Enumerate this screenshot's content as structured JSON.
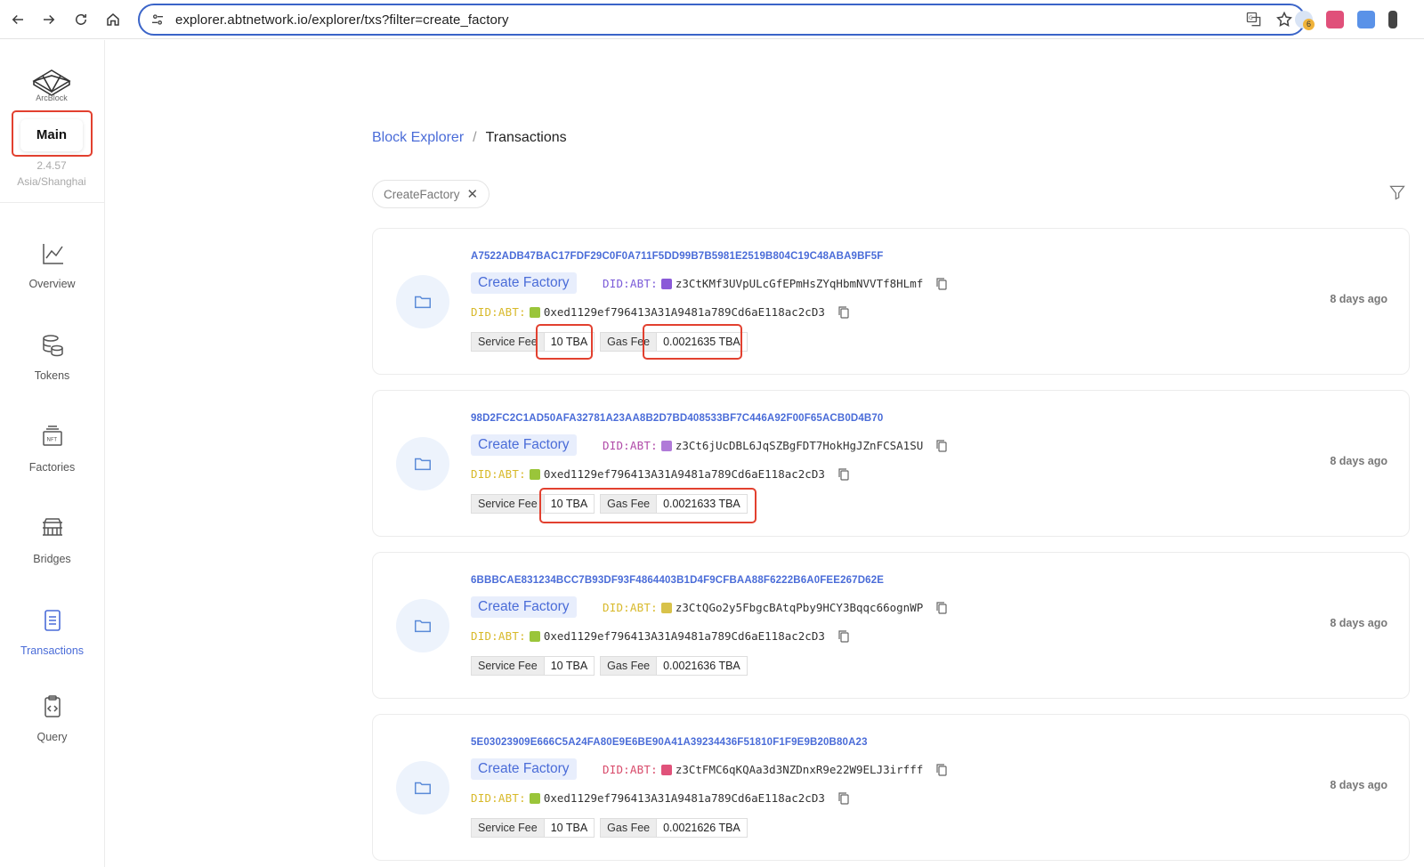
{
  "browser": {
    "url": "explorer.abtnetwork.io/explorer/txs?filter=create_factory",
    "ext_badge": "6"
  },
  "sidebar": {
    "brand": "ArcBlock",
    "network_label": "Main",
    "version": "2.4.57",
    "timezone": "Asia/Shanghai",
    "items": [
      {
        "label": "Overview",
        "icon": "chart-line-icon"
      },
      {
        "label": "Tokens",
        "icon": "coins-icon"
      },
      {
        "label": "Factories",
        "icon": "nft-icon"
      },
      {
        "label": "Bridges",
        "icon": "bridge-icon"
      },
      {
        "label": "Transactions",
        "icon": "document-icon",
        "active": true
      },
      {
        "label": "Query",
        "icon": "query-clipboard-icon"
      }
    ]
  },
  "breadcrumb": {
    "root": "Block Explorer",
    "separator": "/",
    "current": "Transactions"
  },
  "filter": {
    "chip_label": "CreateFactory",
    "chip_close": "✕"
  },
  "transactions": [
    {
      "hash": "A7522ADB47BAC17FDF29C0F0A711F5DD99B7B5981E2519B804C19C48ABA9BF5F",
      "type": "Create Factory",
      "did_prefix": "DID:ABT:",
      "factory_did": "z3CtKMf3UVpULcGfEPmHsZYqHbmNVVTf8HLmf",
      "factory_color": "#8a5ad8",
      "sender_did": "0xed1129ef796413A31A9481a789Cd6aE118ac2cD3",
      "sender_color": "#9ac53a",
      "service_fee_label": "Service Fee",
      "service_fee": "10 TBA",
      "gas_fee_label": "Gas Fee",
      "gas_fee": "0.0021635 TBA",
      "time": "8 days ago"
    },
    {
      "hash": "98D2FC2C1AD50AFA32781A23AA8B2D7BD408533BF7C446A92F00F65ACB0D4B70",
      "type": "Create Factory",
      "did_prefix": "DID:ABT:",
      "factory_did": "z3Ct6jUcDBL6JqSZBgFDT7HokHgJZnFCSA1SU",
      "factory_color": "#b07ad8",
      "sender_did": "0xed1129ef796413A31A9481a789Cd6aE118ac2cD3",
      "sender_color": "#9ac53a",
      "service_fee_label": "Service Fee",
      "service_fee": "10 TBA",
      "gas_fee_label": "Gas Fee",
      "gas_fee": "0.0021633 TBA",
      "time": "8 days ago"
    },
    {
      "hash": "6BBBCAE831234BCC7B93DF93F4864403B1D4F9CFBAA88F6222B6A0FEE267D62E",
      "type": "Create Factory",
      "did_prefix": "DID:ABT:",
      "factory_did": "z3CtQGo2y5FbgcBAtqPby9HCY3Bqqc66ognWP",
      "factory_color": "#d8c24a",
      "sender_did": "0xed1129ef796413A31A9481a789Cd6aE118ac2cD3",
      "sender_color": "#9ac53a",
      "service_fee_label": "Service Fee",
      "service_fee": "10 TBA",
      "gas_fee_label": "Gas Fee",
      "gas_fee": "0.0021636 TBA",
      "time": "8 days ago"
    },
    {
      "hash": "5E03023909E666C5A24FA80E9E6BE90A41A39234436F51810F1F9E9B20B80A23",
      "type": "Create Factory",
      "did_prefix": "DID:ABT:",
      "factory_did": "z3CtFMC6qKQAa3d3NZDnxR9e22W9ELJ3irfff",
      "factory_color": "#e0527a",
      "sender_did": "0xed1129ef796413A31A9481a789Cd6aE118ac2cD3",
      "sender_color": "#9ac53a",
      "service_fee_label": "Service Fee",
      "service_fee": "10 TBA",
      "gas_fee_label": "Gas Fee",
      "gas_fee": "0.0021626 TBA",
      "time": "8 days ago"
    }
  ],
  "colors": {
    "accent": "#4a6cd8",
    "highlight": "#e2402f",
    "did_purple": "#7a5ad8",
    "did_yellow": "#d8b92a",
    "did_pink": "#d84a6a"
  }
}
